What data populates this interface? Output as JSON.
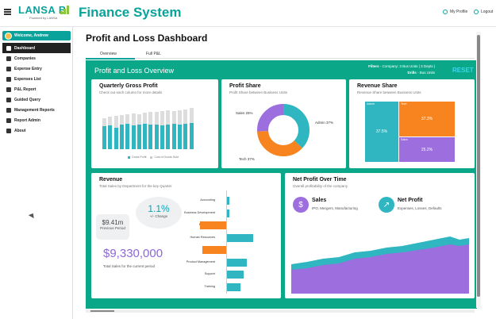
{
  "header": {
    "logo_text": "LANSA BI",
    "logo_sub": "Powered by LANSA",
    "app_title": "Finance System",
    "my_profile": "My Profile",
    "logout": "Logout"
  },
  "sidebar": {
    "welcome": "Welcome, Andrew",
    "items": [
      {
        "label": "Dashboard"
      },
      {
        "label": "Companies"
      },
      {
        "label": "Expense Entry"
      },
      {
        "label": "Expenses List"
      },
      {
        "label": "P&L Report"
      },
      {
        "label": "Guided Query"
      },
      {
        "label": "Management Reports"
      },
      {
        "label": "Report Admin"
      },
      {
        "label": "About"
      }
    ]
  },
  "main": {
    "page_title": "Profit and Loss Dashboard",
    "tabs": [
      {
        "label": "Overview"
      },
      {
        "label": "Full P&L"
      }
    ],
    "overview_title": "Profit and Loss Overview",
    "filters_line1_label": "Filters",
    "filters_line1": "- Company: 3 Bus Units | 3 Depts |",
    "filters_line2_label": "Drills",
    "filters_line2": "- Bus Units",
    "reset": "RESET"
  },
  "gross_profit": {
    "title": "Quarterly Gross Profit",
    "subtitle": "Check out each column for more details",
    "legend_a": "Gross Profit",
    "legend_b": "Cost of Goods Sold"
  },
  "profit_share": {
    "title": "Profit Share",
    "subtitle": "Profit Share between Business Units",
    "labels": {
      "sales": "Sales 25%",
      "admin": "Admin 37%",
      "tech": "Tech 37%"
    }
  },
  "revenue_share": {
    "title": "Revenue Share",
    "subtitle": "Revenue Share between Business Units",
    "admin_label": "Admin",
    "tech_label": "Tech",
    "sales_label": "Sales",
    "admin_val": "37.5%",
    "tech_val": "37.3%",
    "sales_val": "25.2%"
  },
  "revenue": {
    "title": "Revenue",
    "subtitle": "Total Sales by Department for the key Quarter",
    "prev_value": "$9.41m",
    "prev_caption": "Previous Period",
    "change_value": "1.1%",
    "change_caption": "+/- Change",
    "total": "$9,330,000",
    "total_caption": "Total Sales for the current period",
    "departments": [
      {
        "name": "Accounting"
      },
      {
        "name": "Business Development"
      },
      {
        "name": "Engineering"
      },
      {
        "name": "Human Resources"
      },
      {
        "name": "Legal"
      },
      {
        "name": "Product Management"
      },
      {
        "name": "Support"
      },
      {
        "name": "Training"
      }
    ]
  },
  "net_profit": {
    "title": "Net Profit Over Time",
    "subtitle": "Overall profitability of the company",
    "sales_head": "Sales",
    "sales_sub": "IPO, Mergers, Manufacturing",
    "np_head": "Net Profit",
    "np_sub": "Expenses, Losses, Defaults"
  },
  "colors": {
    "teal": "#0aa39b",
    "green_bg": "#0aa888",
    "bar_teal": "#2fb6c0",
    "orange": "#f7841e",
    "purple": "#9c6ede",
    "grey_bar": "#dddddd"
  }
}
